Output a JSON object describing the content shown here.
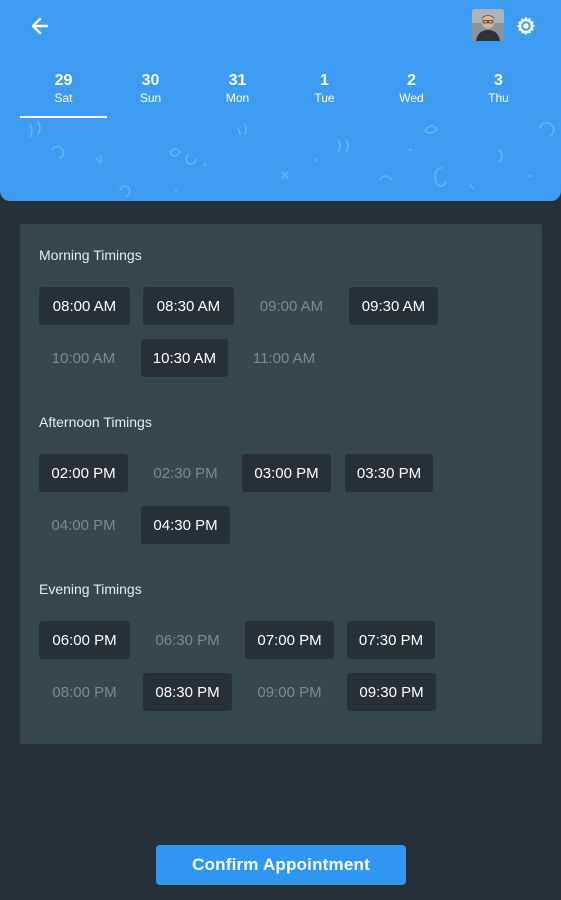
{
  "header": {
    "back_icon": "arrow-left-icon",
    "settings_icon": "gear-icon",
    "dates": [
      {
        "num": "29",
        "day": "Sat",
        "active": true
      },
      {
        "num": "30",
        "day": "Sun",
        "active": false
      },
      {
        "num": "31",
        "day": "Mon",
        "active": false
      },
      {
        "num": "1",
        "day": "Tue",
        "active": false
      },
      {
        "num": "2",
        "day": "Wed",
        "active": false
      },
      {
        "num": "3",
        "day": "Thu",
        "active": false
      }
    ]
  },
  "sections": {
    "morning": {
      "title": "Morning Timings",
      "slots": [
        {
          "time": "08:00 AM",
          "available": true
        },
        {
          "time": "08:30 AM",
          "available": true
        },
        {
          "time": "09:00 AM",
          "available": false
        },
        {
          "time": "09:30 AM",
          "available": true
        },
        {
          "time": "10:00 AM",
          "available": false
        },
        {
          "time": "10:30 AM",
          "available": true
        },
        {
          "time": "11:00 AM",
          "available": false
        }
      ]
    },
    "afternoon": {
      "title": "Afternoon Timings",
      "slots": [
        {
          "time": "02:00 PM",
          "available": true
        },
        {
          "time": "02:30 PM",
          "available": false
        },
        {
          "time": "03:00 PM",
          "available": true
        },
        {
          "time": "03:30 PM",
          "available": true
        },
        {
          "time": "04:00 PM",
          "available": false
        },
        {
          "time": "04:30 PM",
          "available": true
        }
      ]
    },
    "evening": {
      "title": "Evening Timings",
      "slots": [
        {
          "time": "06:00 PM",
          "available": true
        },
        {
          "time": "06:30 PM",
          "available": false
        },
        {
          "time": "07:00 PM",
          "available": true
        },
        {
          "time": "07:30 PM",
          "available": true
        },
        {
          "time": "08:00 PM",
          "available": false
        },
        {
          "time": "08:30 PM",
          "available": true
        },
        {
          "time": "09:00 PM",
          "available": false
        },
        {
          "time": "09:30 PM",
          "available": true
        }
      ]
    }
  },
  "confirm_label": "Confirm Appointment",
  "colors": {
    "header_bg": "#3d9cf1",
    "page_bg": "#263038",
    "card_bg": "#36464f",
    "button_bg": "#2f97f3"
  }
}
